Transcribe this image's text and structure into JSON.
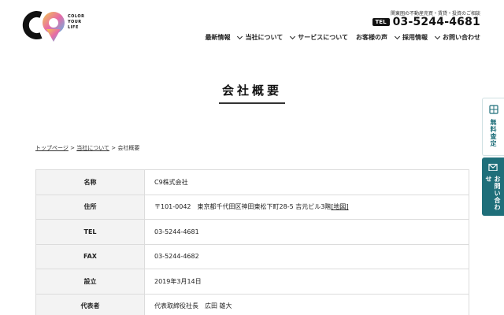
{
  "brand": {
    "logo_text": "COLOR\nYOUR\nLIFE"
  },
  "header": {
    "tagline": "関東圏の不動産売買・賃貸・投資のご相談",
    "tel_badge": "TEL",
    "tel_number": "03-5244-4681"
  },
  "nav": {
    "items": [
      {
        "label": "最新情報",
        "has_dropdown": false
      },
      {
        "label": "当社について",
        "has_dropdown": true
      },
      {
        "label": "サービスについて",
        "has_dropdown": true
      },
      {
        "label": "お客様の声",
        "has_dropdown": false
      },
      {
        "label": "採用情報",
        "has_dropdown": true
      },
      {
        "label": "お問い合わせ",
        "has_dropdown": true
      }
    ]
  },
  "page": {
    "title": "会社概要"
  },
  "breadcrumb": {
    "home": "トップページ",
    "sep": " > ",
    "about": "当社について",
    "current": "会社概要"
  },
  "company": {
    "rows": [
      {
        "label": "名称",
        "value": "C9株式会社"
      },
      {
        "label": "住所",
        "value": "〒101-0042　東京都千代田区神田東松下町28-5 吉元ビル3階",
        "map_link": "[地図]"
      },
      {
        "label": "TEL",
        "value": "03-5244-4681"
      },
      {
        "label": "FAX",
        "value": "03-5244-4682"
      },
      {
        "label": "設立",
        "value": "2019年3月14日"
      },
      {
        "label": "代表者",
        "value": "代表取締役社長　広田 雄大"
      }
    ]
  },
  "side_tabs": {
    "quote": "無料査定",
    "contact": "お問い合わせ"
  },
  "colors": {
    "accent_teal": "#1f6f7a",
    "logo_yellow": "#f2c94c",
    "logo_pink": "#e86aa6",
    "logo_blue": "#5bb8e6"
  }
}
